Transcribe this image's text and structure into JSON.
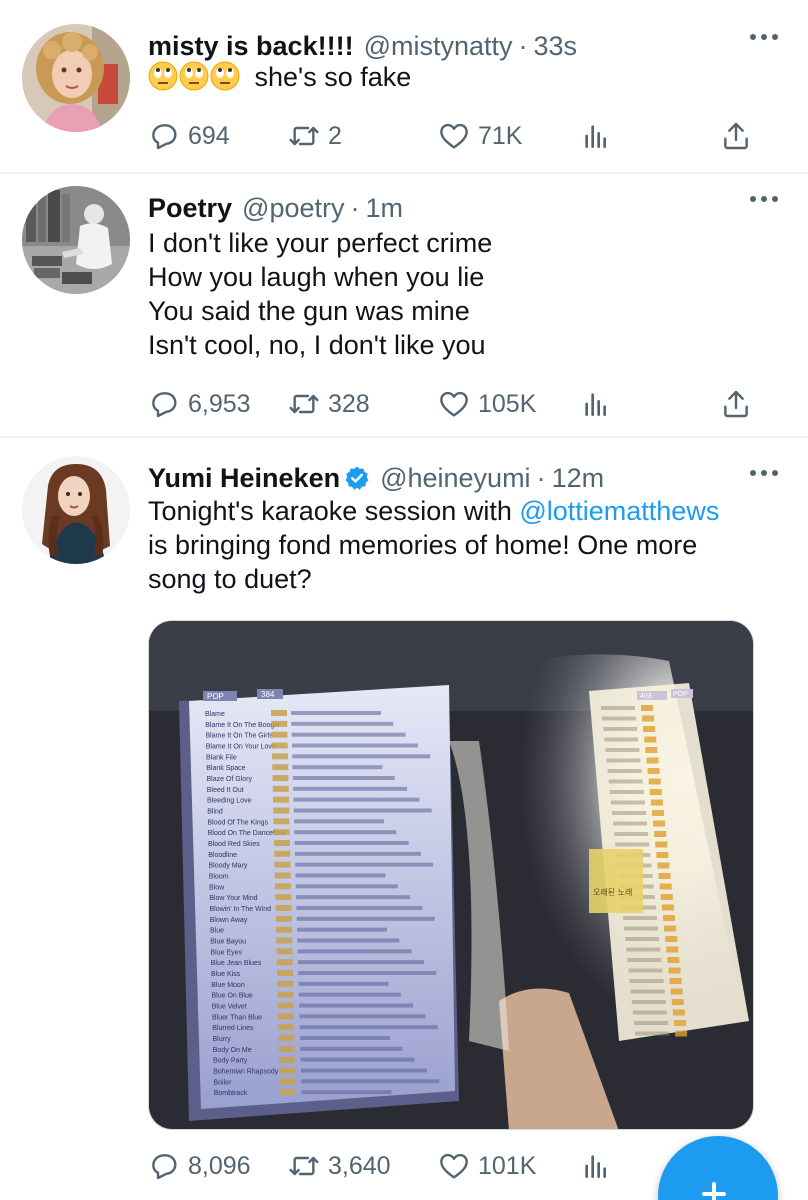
{
  "tweets": [
    {
      "name": "misty is back!!!!",
      "handle": "@mistynatty",
      "time": "33s",
      "emoji": [
        "rolling-eyes-emoji",
        "rolling-eyes-emoji",
        "rolling-eyes-emoji"
      ],
      "text": "she's so fake",
      "replies": "694",
      "retweets": "2",
      "likes": "71K"
    },
    {
      "name": "Poetry",
      "handle": "@poetry",
      "time": "1m",
      "lines": [
        "I don't like your perfect crime",
        "How you laugh when you lie",
        "You said the gun was mine",
        "Isn't cool, no, I don't like you"
      ],
      "replies": "6,953",
      "retweets": "328",
      "likes": "105K"
    },
    {
      "name": "Yumi Heineken",
      "verified": true,
      "handle": "@heineyumi",
      "time": "12m",
      "text_before": "Tonight's karaoke session with ",
      "mention": "@lottiematthews",
      "line2": "is bringing fond memories of home! One more",
      "line3": "song to duet?",
      "media": {
        "left_page_header": "POP",
        "left_page_number": "384",
        "left_page_songs": [
          "Blame",
          "Blame It On The Boogie",
          "Blame It On The Girls",
          "Blame It On Your Love",
          "Blank File",
          "Blank Space",
          "Blaze Of Glory",
          "Bleed It Out",
          "Bleeding Love",
          "Blind",
          "Blood Of The Kings",
          "Blood On The Dancefloor",
          "Blood Red Skies",
          "Bloodline",
          "Bloody Mary",
          "Bloom",
          "Blow",
          "Blow Your Mind",
          "Blowin' In The Wind",
          "Blown Away",
          "Blue",
          "Blue Bayou",
          "Blue Eyes",
          "Blue Jean Blues",
          "Blue Kiss",
          "Blue Moon",
          "Blue On Blue",
          "Blue Velvet",
          "Bluer Than Blue",
          "Blurred Lines",
          "Blurry",
          "Body On Me",
          "Body Party",
          "Bohemian Rhapsody",
          "Boiler",
          "Bombtrack"
        ],
        "right_page_header": "POP",
        "right_page_number": "403",
        "sticky_note": "오래된 노래"
      },
      "replies": "8,096",
      "retweets": "3,640",
      "likes": "101K"
    }
  ],
  "colors": {
    "text_primary": "#0f1419",
    "text_secondary": "#536471",
    "accent": "#1d9bf0",
    "divider": "#eff3f4"
  },
  "icons": {
    "reply": "reply-icon",
    "retweet": "retweet-icon",
    "like": "heart-icon",
    "analytics": "analytics-icon",
    "share": "share-icon",
    "more": "more-icon",
    "compose": "plus-icon"
  }
}
